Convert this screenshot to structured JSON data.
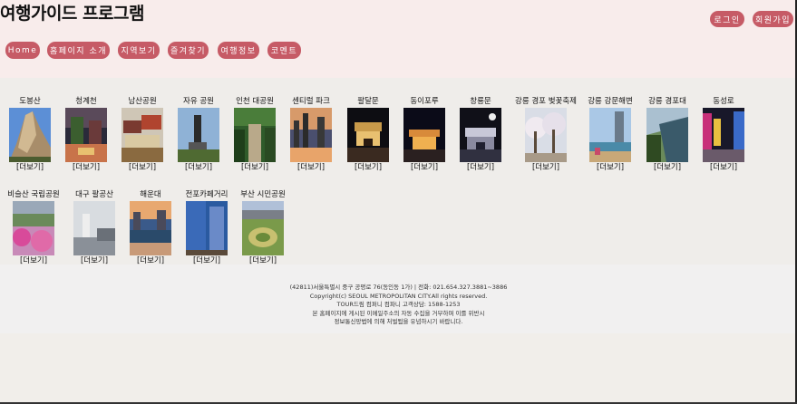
{
  "header": {
    "title": "여행가이드 프로그램",
    "login_label": "로그인",
    "signup_label": "회원가입"
  },
  "nav": {
    "items": [
      "Home",
      "홈페이지 소개",
      "지역보기",
      "즐겨찾기",
      "여행정보",
      "코멘트"
    ]
  },
  "places": [
    {
      "name": "도봉산",
      "more": "[더보기]"
    },
    {
      "name": "청계천",
      "more": "[더보기]"
    },
    {
      "name": "남산공원",
      "more": "[더보기]"
    },
    {
      "name": "자유 공원",
      "more": "[더보기]"
    },
    {
      "name": "인천 대공원",
      "more": "[더보기]"
    },
    {
      "name": "센티럴 파크",
      "more": "[더보기]"
    },
    {
      "name": "팔달문",
      "more": "[더보기]"
    },
    {
      "name": "동이포루",
      "more": "[더보기]"
    },
    {
      "name": "창룡문",
      "more": "[더보기]"
    },
    {
      "name": "강릉 경포 벚꽃축제",
      "more": "[더보기]"
    },
    {
      "name": "강릉 강문해변",
      "more": "[더보기]"
    },
    {
      "name": "강릉 경포대",
      "more": "[더보기]"
    },
    {
      "name": "동성로",
      "more": "[더보기]"
    },
    {
      "name": "비슬산 국립공원",
      "more": "[더보기]"
    },
    {
      "name": "대구 팔공산",
      "more": "[더보기]"
    },
    {
      "name": "해운대",
      "more": "[더보기]"
    },
    {
      "name": "전포카페거리",
      "more": "[더보기]"
    },
    {
      "name": "부산 시민공원",
      "more": "[더보기]"
    }
  ],
  "footer": {
    "address": "(42811)서울특별시 중구 공평로 76(동인동 1가) | 전화: 021.654.327.3881~3886",
    "copyright": "Copyright(c) SEOUL METROPOLITAN CITY.All rights reserved.",
    "contact": "TOUR드림 컴퍼니 컴파니 고객상담: 1588-1253",
    "notice1": "본 홈페이지에 게시된 이메일주소의 자동 수집을 거부하며 이를 위반시",
    "notice2": "정보통신망법에 의해 처벌됨을 유념하시기 바랍니다."
  }
}
